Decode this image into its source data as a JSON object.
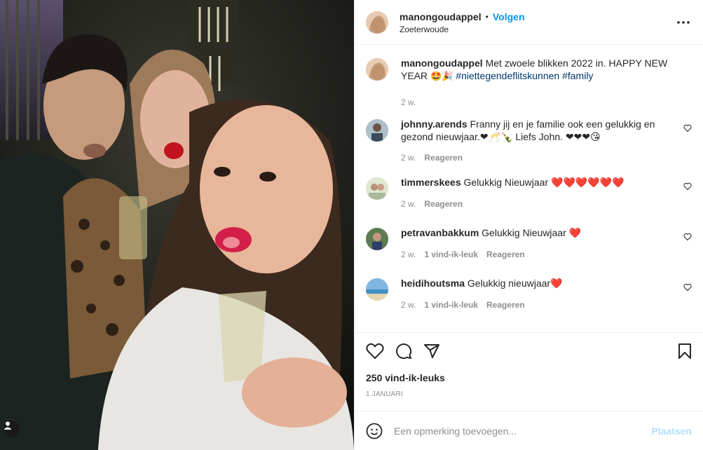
{
  "header": {
    "username": "manongoudappel",
    "separator": "•",
    "follow_label": "Volgen",
    "location": "Zoeterwoude"
  },
  "caption": {
    "username": "manongoudappel",
    "text": "Met zwoele blikken 2022 in. HAPPY NEW YEAR",
    "emojis": "🤩🎉",
    "hashtag1": "#niettegendeflitskunnen",
    "hashtag2": "#family",
    "time": "2 w."
  },
  "comments": [
    {
      "username": "johnny.arends",
      "text": "Franny jij en je familie ook een gelukkig en gezond nieuwjaar.❤🥂🍾 Liefs John. ❤❤❤😘",
      "time": "2 w.",
      "likes": "",
      "reply": "Reageren"
    },
    {
      "username": "timmerskees",
      "text": "Gelukkig Nieuwjaar",
      "hearts": "❤️❤️❤️❤️❤️❤️",
      "time": "2 w.",
      "likes": "",
      "reply": "Reageren"
    },
    {
      "username": "petravanbakkum",
      "text": "Gelukkig Nieuwjaar",
      "hearts": "❤️",
      "time": "2 w.",
      "likes": "1 vind-ik-leuk",
      "reply": "Reageren"
    },
    {
      "username": "heidihoutsma",
      "text": "Gelukkig nieuwjaar",
      "hearts": "❤️",
      "time": "2 w.",
      "likes": "1 vind-ik-leuk",
      "reply": "Reageren"
    }
  ],
  "stats": {
    "likes": "250 vind-ik-leuks",
    "date": "1 JANUARI"
  },
  "add_comment": {
    "placeholder": "Een opmerking toevoegen...",
    "post_label": "Plaatsen"
  },
  "icons": {
    "more": "more-horizontal-icon",
    "like": "heart-icon",
    "comment": "comment-icon",
    "share": "paper-plane-icon",
    "save": "bookmark-icon",
    "emoji": "smiley-icon",
    "tag": "user-tag-icon"
  },
  "colors": {
    "accent": "#0095f6",
    "post_disabled": "#b2dffc",
    "hashtag": "#00376b",
    "muted": "#8e8e8e"
  }
}
